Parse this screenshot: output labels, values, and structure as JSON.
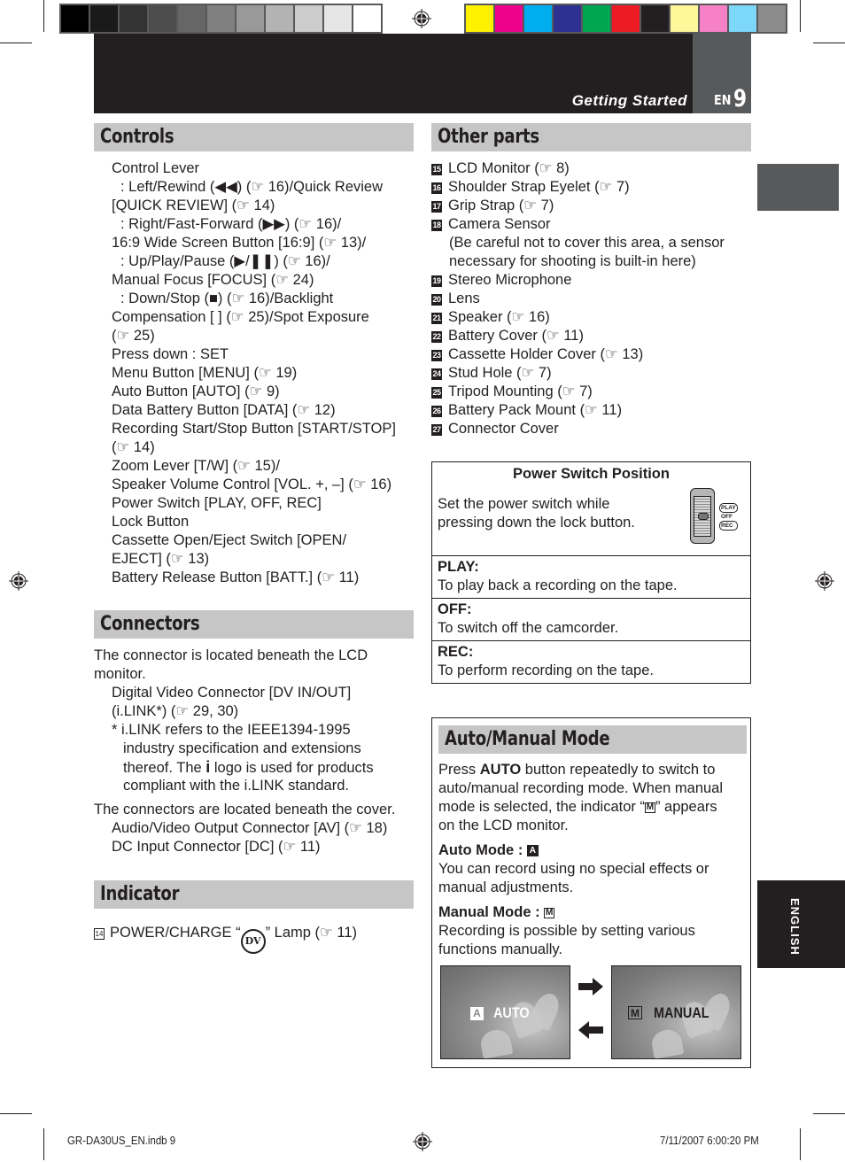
{
  "color_strip": {
    "grays": [
      "#000000",
      "#1a1a1a",
      "#333333",
      "#4d4d4d",
      "#666666",
      "#808080",
      "#999999",
      "#b3b3b3",
      "#cccccc",
      "#e6e6e6",
      "#ffffff"
    ],
    "colors": [
      "#fff200",
      "#ec008c",
      "#00aeef",
      "#2e3192",
      "#00a651",
      "#ed1c24",
      "#231f20",
      "#fff799",
      "#f681c6",
      "#7dd7f8",
      "#8c8c8c"
    ]
  },
  "header": {
    "title": "Getting Started",
    "lang": "EN",
    "page_number": "9"
  },
  "controls": {
    "heading": "Controls",
    "lines": [
      {
        "text": "Control Lever",
        "indent": false
      },
      {
        "text": " : Left/Rewind (◀◀) (☞ 16)/Quick Review",
        "indent": true
      },
      {
        "text": "[QUICK REVIEW] (☞ 14)",
        "indent": false
      },
      {
        "text": " : Right/Fast-Forward (▶▶) (☞ 16)/",
        "indent": true
      },
      {
        "text": "16:9 Wide Screen Button [16:9] (☞ 13)/",
        "indent": false
      },
      {
        "text": "  : Up/Play/Pause (▶/❚❚) (☞ 16)/",
        "indent": true
      },
      {
        "text": "Manual Focus [FOCUS] (☞ 24)",
        "indent": false
      },
      {
        "text": "  : Down/Stop (■) (☞ 16)/Backlight",
        "indent": true
      },
      {
        "text": "Compensation [    ] (☞ 25)/Spot Exposure",
        "indent": false
      },
      {
        "text": "(☞ 25)",
        "indent": false
      },
      {
        "text": "Press down : SET",
        "indent": false
      },
      {
        "text": "Menu Button [MENU] (☞ 19)",
        "indent": false
      },
      {
        "text": "Auto Button [AUTO] (☞ 9)",
        "indent": false
      },
      {
        "text": "Data Battery Button [DATA] (☞ 12)",
        "indent": false
      },
      {
        "text": "Recording Start/Stop Button [START/STOP]",
        "indent": false
      },
      {
        "text": "(☞ 14)",
        "indent": false
      },
      {
        "text": "Zoom Lever [T/W] (☞ 15)/",
        "indent": false
      },
      {
        "text": "Speaker Volume Control [VOL. +, –] (☞ 16)",
        "indent": false
      },
      {
        "text": "Power Switch [PLAY, OFF, REC]",
        "indent": false
      },
      {
        "text": "Lock Button",
        "indent": false
      },
      {
        "text": "Cassette Open/Eject Switch [OPEN/",
        "indent": false
      },
      {
        "text": "EJECT] (☞ 13)",
        "indent": false
      },
      {
        "text": "Battery Release Button [BATT.] (☞ 11)",
        "indent": false
      }
    ]
  },
  "connectors": {
    "heading": "Connectors",
    "intro1": [
      "The connector is located beneath the LCD",
      "monitor."
    ],
    "items1": [
      "Digital Video Connector [DV IN/OUT]",
      "(i.LINK*) (☞ 29, 30)"
    ],
    "footnote": [
      "* i.LINK refers to the IEEE1394-1995",
      "industry specification and extensions",
      "thereof. The ",
      " logo is used for products",
      "compliant with the i.LINK standard."
    ],
    "intro2": "The connectors are located beneath the cover.",
    "items2": [
      "Audio/Video Output Connector [AV] (☞ 18)",
      "DC Input Connector [DC] (☞ 11)"
    ]
  },
  "indicator": {
    "heading": "Indicator",
    "number": "14",
    "text_before": "POWER/CHARGE “",
    "icon_label": "DV",
    "text_after": "” Lamp (☞ 11)"
  },
  "other_parts": {
    "heading": "Other parts",
    "items": [
      {
        "num": "15",
        "lines": [
          "LCD Monitor (☞ 8)"
        ]
      },
      {
        "num": "16",
        "lines": [
          "Shoulder Strap Eyelet (☞ 7)"
        ]
      },
      {
        "num": "17",
        "lines": [
          "Grip Strap (☞ 7)"
        ]
      },
      {
        "num": "18",
        "lines": [
          "Camera Sensor",
          "(Be careful not to cover this area, a sensor",
          "necessary for shooting is built-in here)"
        ]
      },
      {
        "num": "19",
        "lines": [
          "Stereo Microphone"
        ]
      },
      {
        "num": "20",
        "lines": [
          "Lens"
        ]
      },
      {
        "num": "21",
        "lines": [
          "Speaker (☞ 16)"
        ]
      },
      {
        "num": "22",
        "lines": [
          "Battery Cover (☞ 11)"
        ]
      },
      {
        "num": "23",
        "lines": [
          "Cassette Holder Cover (☞ 13)"
        ]
      },
      {
        "num": "24",
        "lines": [
          "Stud Hole (☞ 7)"
        ]
      },
      {
        "num": "25",
        "lines": [
          "Tripod Mounting (☞ 7)"
        ]
      },
      {
        "num": "26",
        "lines": [
          "Battery Pack Mount (☞ 11)"
        ]
      },
      {
        "num": "27",
        "lines": [
          "Connector Cover"
        ]
      }
    ]
  },
  "power_switch": {
    "title": "Power Switch Position",
    "description": [
      "Set the power switch while",
      "pressing down the lock button."
    ],
    "switch_labels": [
      "PLAY",
      "OFF",
      "REC"
    ],
    "rows": [
      {
        "label": "PLAY:",
        "text": "To play back a recording on the tape."
      },
      {
        "label": "OFF:",
        "text": "To switch off the camcorder."
      },
      {
        "label": "REC:",
        "text": "To perform recording on the tape."
      }
    ]
  },
  "auto_manual": {
    "heading": "Auto/Manual Mode",
    "intro_pre": "Press ",
    "intro_bold": "AUTO",
    "intro_lines": [
      " button repeatedly to switch to",
      "auto/manual recording mode.  When manual",
      "mode is selected, the indicator “",
      "” appears",
      "on the LCD monitor."
    ],
    "auto_label": "Auto Mode : ",
    "auto_icon": "A",
    "auto_text": [
      "You can record using no special effects or",
      "manual adjustments."
    ],
    "manual_label": "Manual Mode : ",
    "manual_icon": "M",
    "manual_text": [
      "Recording is possible by setting various",
      "functions manually."
    ],
    "screen_auto": {
      "icon": "A",
      "label": "AUTO"
    },
    "screen_manual": {
      "icon": "M",
      "label": "MANUAL"
    }
  },
  "side_tab": {
    "label": "ENGLISH"
  },
  "footer": {
    "file": "GR-DA30US_EN.indb   9",
    "timestamp": "7/11/2007   6:00:20 PM"
  }
}
